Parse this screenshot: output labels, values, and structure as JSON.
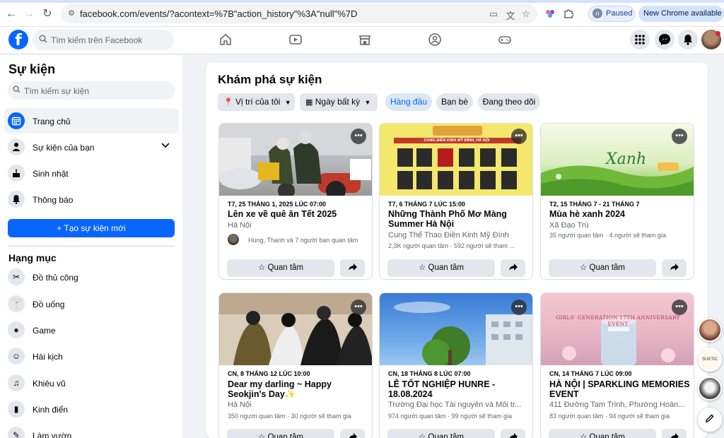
{
  "browser": {
    "url": "facebook.com/events/?acontext=%7B\"action_history\"%3A\"null\"%7D",
    "profile_status": "Paused",
    "profile_initial": "n",
    "update_label": "New Chrome available"
  },
  "header": {
    "search_placeholder": "Tìm kiếm trên Facebook",
    "logo_letter": "f"
  },
  "sidebar": {
    "title": "Sự kiện",
    "search_placeholder": "Tìm kiếm sự kiện",
    "items": [
      {
        "label": "Trang chủ",
        "icon": "calendar-icon"
      },
      {
        "label": "Sự kiện của bạn",
        "icon": "person-icon"
      },
      {
        "label": "Sinh nhật",
        "icon": "cake-icon"
      },
      {
        "label": "Thông báo",
        "icon": "bell-icon"
      }
    ],
    "create_label": "+ Tạo sự kiện mới",
    "section_title": "Hạng mục",
    "categories": [
      {
        "label": "Đồ thủ công",
        "icon": "scissors-icon"
      },
      {
        "label": "Đồ uống",
        "icon": "cocktail-icon"
      },
      {
        "label": "Game",
        "icon": "game-icon"
      },
      {
        "label": "Hài kịch",
        "icon": "comedy-icon"
      },
      {
        "label": "Khiêu vũ",
        "icon": "dance-icon"
      },
      {
        "label": "Kinh điển",
        "icon": "book-icon"
      },
      {
        "label": "Làm vườn",
        "icon": "garden-icon"
      }
    ]
  },
  "main": {
    "title": "Khám phá sự kiện",
    "filters": {
      "location": "Vị trí của tôi",
      "date": "Ngày bất kỳ"
    },
    "tabs": [
      {
        "label": "Hàng đầu",
        "active": true
      },
      {
        "label": "Bạn bè",
        "active": false
      },
      {
        "label": "Đang theo dõi",
        "active": false
      }
    ],
    "interest_label": "Quan tâm",
    "events": [
      {
        "date": "T7, 25 THÁNG 1, 2025 LÚC 07:00",
        "title": "Lên xe về quê ăn Tết 2025",
        "place": "Hà Nội",
        "stats": "Hung, Thanh và 7 người bạn quan tâm",
        "has_friends": true,
        "image_note": "Tết motorbike"
      },
      {
        "date": "T7, 6 THÁNG 7 LÚC 15:00",
        "title": "Những Thành Phố Mơ Màng Summer Hà Nội",
        "place": "Cung Thể Thao Điền Kinh Mỹ Đình",
        "stats": "2,3K người quan tâm · 592 người sẽ tham ...",
        "has_friends": false,
        "banner_text": "CUNG ĐIỀN KINH MỸ ĐÌNH, HÀ NỘI"
      },
      {
        "date": "T2, 15 THÁNG 7 - 21 THÁNG 7",
        "title": "Mùa hè xanh 2024",
        "place": "Xã Đạo Trù",
        "stats": "35 người quan tâm · 4 người sẽ tham gia",
        "has_friends": false,
        "banner_text": "Xanh"
      },
      {
        "date": "CN, 8 THÁNG 12 LÚC 10:00",
        "title": "Dear my darling ~ Happy Seokjin's Day✨",
        "place": "Hà Nội",
        "stats": "350 người quan tâm · 30 người sẽ tham gia",
        "has_friends": false
      },
      {
        "date": "CN, 18 THÁNG 8 LÚC 07:00",
        "title": "LỄ TỐT NGHIỆP HUNRE - 18.08.2024",
        "place": "Trường Đại học Tài nguyên và Môi tr...",
        "stats": "974 người quan tâm · 99 người sẽ tham gia",
        "has_friends": false
      },
      {
        "date": "CN, 14 THÁNG 7 LÚC 09:00",
        "title": "HÀ NỘI | SPARKLING MEMORIES EVENT",
        "place": "411 Đường Tam Trinh, Phường Hoàn...",
        "stats": "83 người quan tâm · 94 người sẽ tham gia",
        "has_friends": false,
        "banner_text": "GIRLS' GENERATION 17TH ANNIVERSARY EVENT"
      }
    ]
  },
  "floating": {
    "avatar_text": "SUKTIC"
  }
}
